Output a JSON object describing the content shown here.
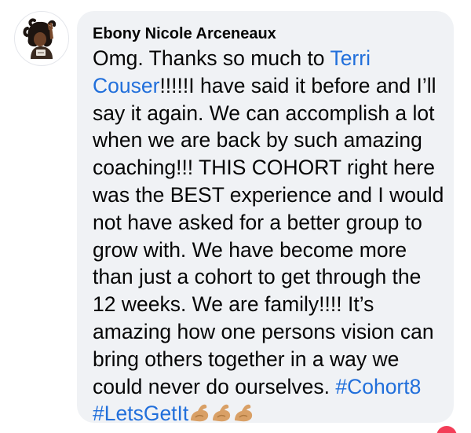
{
  "comment": {
    "author": "Ebony Nicole Arceneaux",
    "lines": [
      "Omg. Thanks so much to ",
      "Terri",
      "Couser",
      "!!!!!I have said it before and I’ll",
      "say it again. We can accomplish a lot",
      "when we are back by such amazing",
      "coaching!!! THIS COHORT right here",
      "was the BEST experience and I would",
      "not have asked for a better group to",
      "grow with. We have become more",
      "than just a cohort to get through the",
      "12 weeks. We are family!!!! It’s",
      "amazing how one persons vision can",
      "bring others together in a way we",
      "could never do ourselves. ",
      "#Cohort8",
      "#LetsGetIt"
    ],
    "emoji_icons": [
      "flexed-biceps-icon",
      "flexed-biceps-icon",
      "flexed-biceps-icon"
    ]
  },
  "colors": {
    "bubble_bg": "#f0f2f5",
    "text": "#050505",
    "link": "#216fdb",
    "emoji_skin": "#d9a066"
  }
}
